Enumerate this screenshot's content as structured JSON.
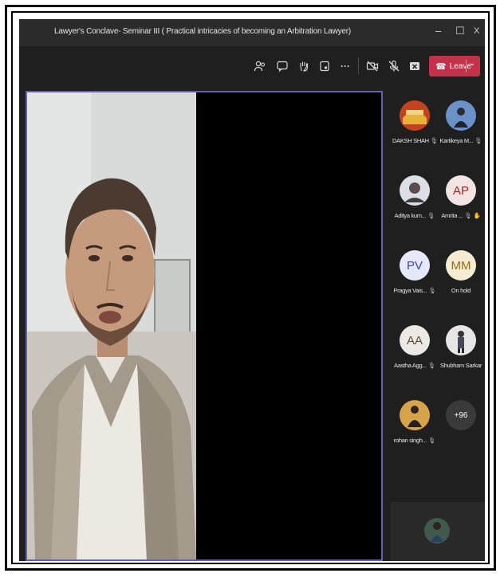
{
  "window": {
    "title": "Lawyer's Conclave- Seminar III ( Practical intricacies of becoming an Arbitration Lawyer)",
    "controls": [
      "–",
      "☐",
      "X"
    ]
  },
  "toolbar": {
    "icons": [
      "people-icon",
      "chat-icon",
      "raise-hand-icon",
      "rooms-icon",
      "more-icon",
      "camera-off-icon",
      "mic-off-icon",
      "share-icon"
    ],
    "more_label": "···",
    "leave_label": "Leave",
    "leave_color": "#c4314b"
  },
  "participants": [
    {
      "name": "DAKSH SHAH",
      "avatar": "photo",
      "mic": "muted"
    },
    {
      "name": "Kartikeya M...",
      "avatar": "photo",
      "mic": "muted"
    },
    {
      "name": "Aditya kum...",
      "avatar": "photo",
      "mic": "muted"
    },
    {
      "name": "Amrita ...",
      "initials": "AP",
      "mic": "muted",
      "hand": "raised"
    },
    {
      "name": "Pragya Vais...",
      "initials": "PV",
      "mic": "muted"
    },
    {
      "name": "On hold",
      "initials": "MM"
    },
    {
      "name": "Aastha Agg...",
      "initials": "AA",
      "mic": "muted"
    },
    {
      "name": "Shubham Sarkar",
      "avatar": "photo",
      "mic": "muted"
    },
    {
      "name": "rohan singh...",
      "avatar": "photo",
      "mic": "muted"
    }
  ],
  "overflow_count": "+96",
  "colors": {
    "accent_border": "#6264a7",
    "background": "#1f1f1f"
  }
}
